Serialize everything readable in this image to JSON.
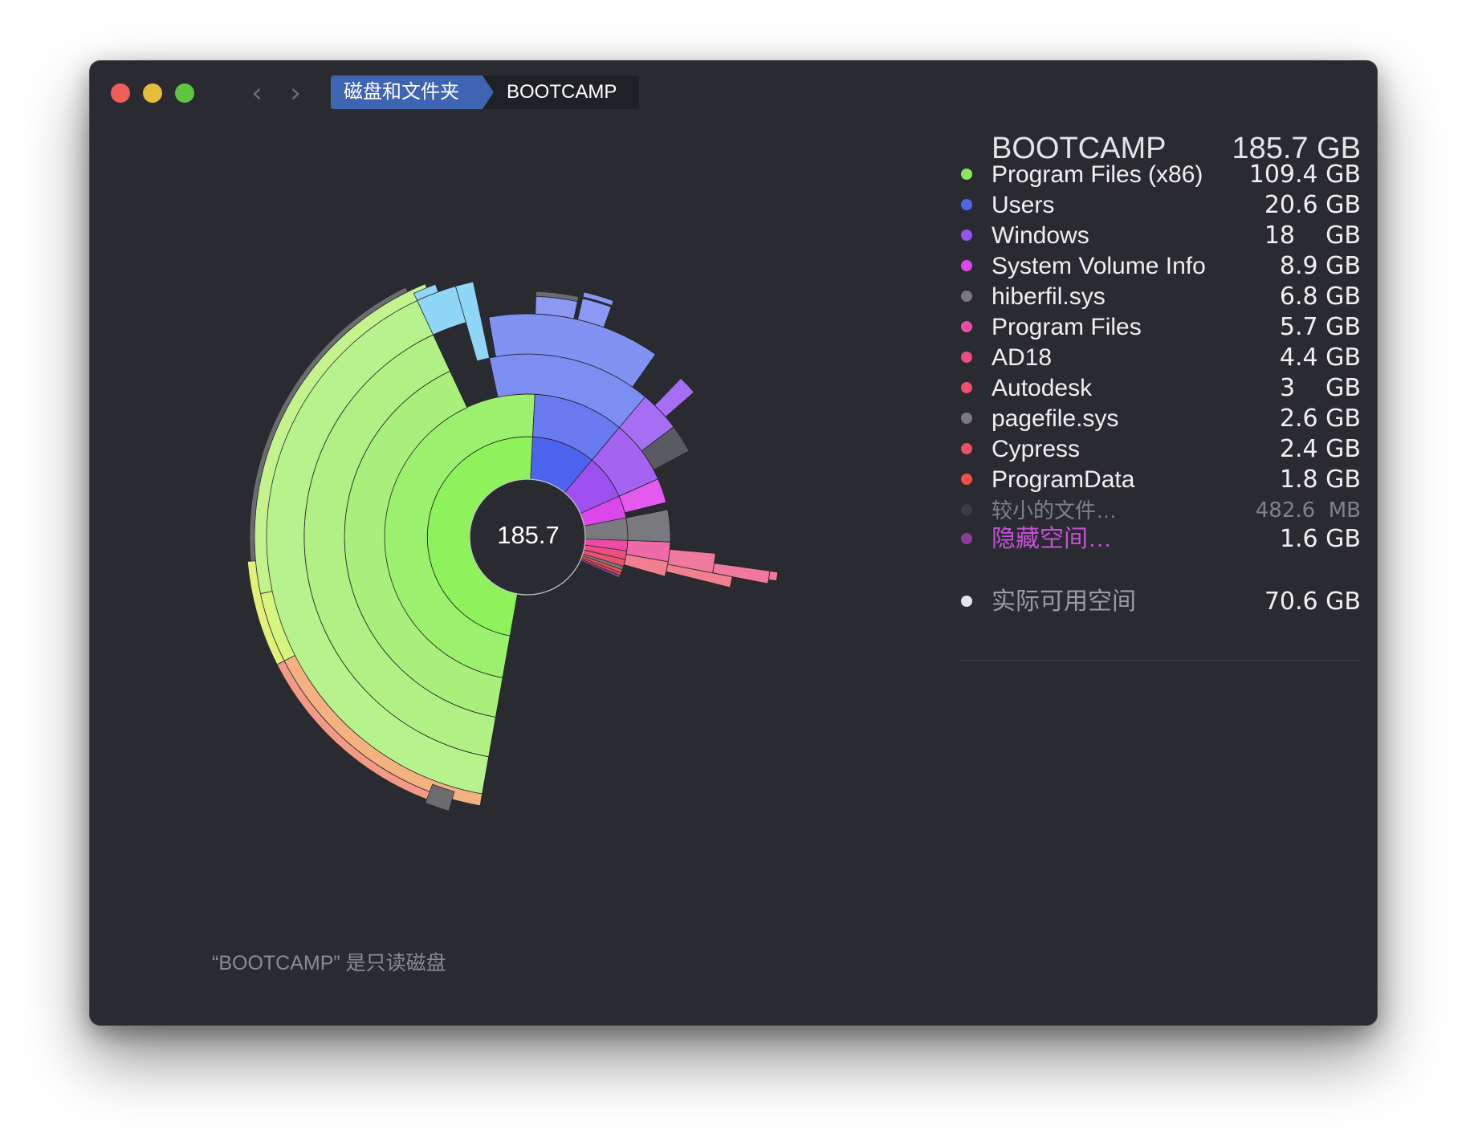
{
  "window": {
    "center_value": "185.7",
    "readonly_note": "“BOOTCAMP” 是只读磁盘"
  },
  "toolbar": {
    "back_icon": "‹",
    "forward_icon": "›"
  },
  "breadcrumb": [
    "磁盘和文件夹",
    "BOOTCAMP"
  ],
  "panel": {
    "title": "BOOTCAMP",
    "total": "185.7 GB",
    "items": [
      {
        "name": "Program Files (x86)",
        "size": "109.4 GB",
        "color": "#8be75a"
      },
      {
        "name": "Users",
        "size": "20.6 GB",
        "color": "#4f66ee"
      },
      {
        "name": "Windows",
        "size": "18    GB",
        "color": "#9a52ee"
      },
      {
        "name": "System Volume Info",
        "size": "8.9 GB",
        "color": "#dd46ea"
      },
      {
        "name": "hiberfil.sys",
        "size": "6.8 GB",
        "color": "#7a7a7e"
      },
      {
        "name": "Program Files",
        "size": "5.7 GB",
        "color": "#ee4aa8"
      },
      {
        "name": "AD18",
        "size": "4.4 GB",
        "color": "#ec4d85"
      },
      {
        "name": "Autodesk",
        "size": "3    GB",
        "color": "#ec4f70"
      },
      {
        "name": "pagefile.sys",
        "size": "2.6 GB",
        "color": "#7a7a7e"
      },
      {
        "name": "Cypress",
        "size": "2.4 GB",
        "color": "#ec4f5e"
      },
      {
        "name": "ProgramData",
        "size": "1.8 GB",
        "color": "#ee4d4a"
      },
      {
        "name": "较小的文件…",
        "size": "482.6  MB",
        "color": "#3c3d43"
      },
      {
        "name": "隐藏空间…",
        "size": "1.6 GB",
        "color": "#8a3f96"
      }
    ],
    "free": {
      "name": "实际可用空间",
      "size": "70.6 GB",
      "color": "#e4e5e8"
    }
  }
}
